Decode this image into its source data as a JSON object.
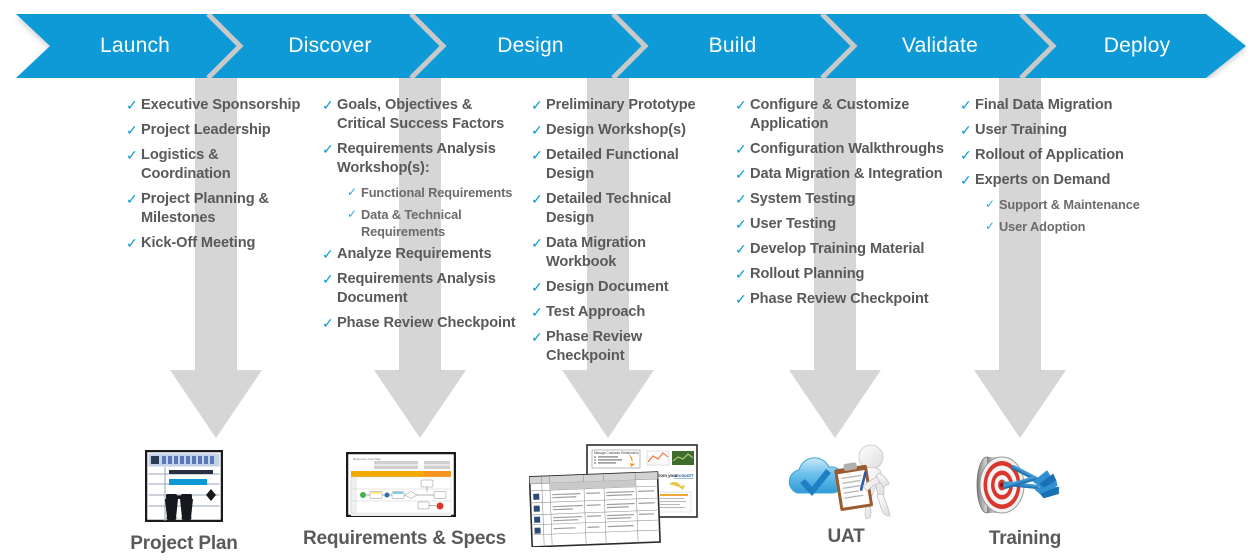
{
  "banner": {
    "accent_color": "#0C9AD7",
    "separator_color": "#c9c9c9",
    "phases": [
      {
        "label": "Launch"
      },
      {
        "label": "Discover"
      },
      {
        "label": "Design"
      },
      {
        "label": "Build"
      },
      {
        "label": "Validate"
      },
      {
        "label": "Deploy"
      }
    ]
  },
  "arrow_color": "#d6d6d6",
  "check_color": "#0C9AD7",
  "text_color": "#595959",
  "columns": [
    {
      "phase": "Launch",
      "items": [
        {
          "text": "Executive Sponsorship",
          "level": 1
        },
        {
          "text": "Project Leadership",
          "level": 1
        },
        {
          "text": "Logistics & Coordination",
          "level": 1
        },
        {
          "text": "Project Planning & Milestones",
          "level": 1
        },
        {
          "text": "Kick-Off Meeting",
          "level": 1
        }
      ]
    },
    {
      "phase": "Discover",
      "items": [
        {
          "text": "Goals, Objectives & Critical Success Factors",
          "level": 1
        },
        {
          "text": "Requirements Analysis Workshop(s):",
          "level": 1
        },
        {
          "text": "Functional Requirements",
          "level": 2
        },
        {
          "text": "Data & Technical Requirements",
          "level": 2
        },
        {
          "text": "Analyze Requirements",
          "level": 1
        },
        {
          "text": "Requirements Analysis Document",
          "level": 1
        },
        {
          "text": "Phase Review Checkpoint",
          "level": 1
        }
      ]
    },
    {
      "phase": "Design",
      "items": [
        {
          "text": "Preliminary Prototype",
          "level": 1
        },
        {
          "text": "Design Workshop(s)",
          "level": 1
        },
        {
          "text": "Detailed Functional Design",
          "level": 1
        },
        {
          "text": "Detailed Technical Design",
          "level": 1
        },
        {
          "text": "Data Migration Workbook",
          "level": 1
        },
        {
          "text": "Design Document",
          "level": 1
        },
        {
          "text": "Test Approach",
          "level": 1
        },
        {
          "text": "Phase Review Checkpoint",
          "level": 1
        }
      ]
    },
    {
      "phase": "Build",
      "items": [
        {
          "text": "Configure & Customize Application",
          "level": 1
        },
        {
          "text": "Configuration Walkthroughs",
          "level": 1
        },
        {
          "text": "Data Migration & Integration",
          "level": 1
        },
        {
          "text": "System Testing",
          "level": 1
        },
        {
          "text": "User Testing",
          "level": 1
        },
        {
          "text": "Develop Training Material",
          "level": 1
        },
        {
          "text": "Rollout Planning",
          "level": 1
        },
        {
          "text": "Phase Review Checkpoint",
          "level": 1
        }
      ]
    },
    {
      "phase": "Deploy",
      "items": [
        {
          "text": "Final Data Migration",
          "level": 1
        },
        {
          "text": "User Training",
          "level": 1
        },
        {
          "text": "Rollout of Application",
          "level": 1
        },
        {
          "text": "Experts on Demand",
          "level": 1
        },
        {
          "text": "Support & Maintenance",
          "level": 2
        },
        {
          "text": "User Adoption",
          "level": 2
        }
      ]
    }
  ],
  "deliverables": [
    {
      "label": "Project Plan",
      "icon": "gantt-chart-binoculars-icon"
    },
    {
      "label": "Requirements & Specs",
      "icon": "process-flow-diagram-icon"
    },
    {
      "label": "",
      "icon": "stacked-documents-icon"
    },
    {
      "label": "UAT",
      "icon": "cloud-check-clipboard-person-icon"
    },
    {
      "label": "Training",
      "icon": "dartboard-darts-icon"
    }
  ],
  "check_glyph": "✓"
}
